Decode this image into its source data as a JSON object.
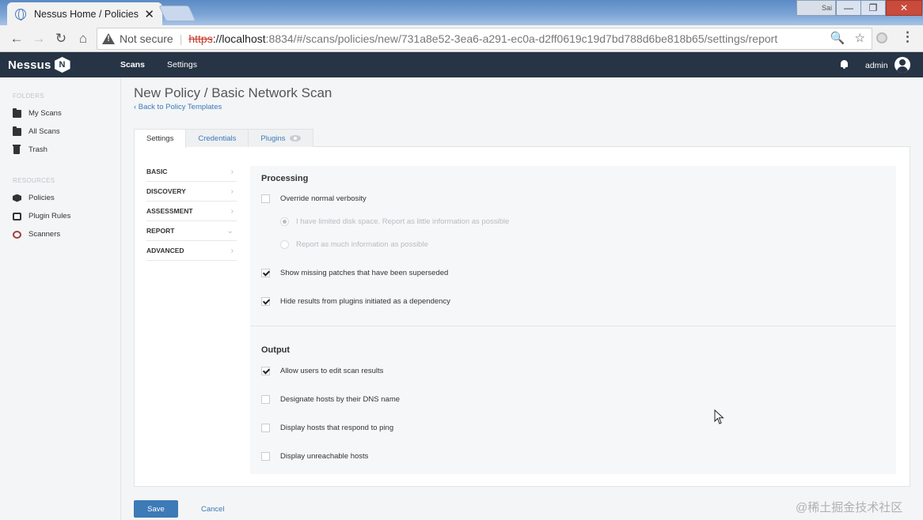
{
  "browser": {
    "tab_title": "Nessus Home / Policies /",
    "tab_close": "✕",
    "profile_label": "Sai",
    "minimize": "—",
    "restore": "❐",
    "close": "✕",
    "back": "←",
    "forward": "→",
    "reload": "↻",
    "home": "⌂",
    "security_label": "Not secure",
    "separator": "|",
    "url_scheme": "https",
    "url_host": "://localhost",
    "url_path": ":8834/#/scans/policies/new/731a8e52-3ea6-a291-ec0a-d2ff0619c19d7bd788d6be818b65/settings/report",
    "zoom_icon": "🔍",
    "bookmark_icon": "☆",
    "menu": "⋮"
  },
  "topnav": {
    "logo_text": "Nessus",
    "logo_badge": "N",
    "scans": "Scans",
    "settings": "Settings",
    "user": "admin"
  },
  "sidebar": {
    "folders_heading": "FOLDERS",
    "my_scans": "My Scans",
    "all_scans": "All Scans",
    "trash": "Trash",
    "resources_heading": "RESOURCES",
    "policies": "Policies",
    "plugin_rules": "Plugin Rules",
    "scanners": "Scanners"
  },
  "page": {
    "title": "New Policy / Basic Network Scan",
    "back_link": "‹ Back to Policy Templates"
  },
  "tabs": {
    "settings": "Settings",
    "credentials": "Credentials",
    "plugins": "Plugins"
  },
  "section_nav": [
    {
      "label": "BASIC",
      "chevron": "›"
    },
    {
      "label": "DISCOVERY",
      "chevron": "›"
    },
    {
      "label": "ASSESSMENT",
      "chevron": "›"
    },
    {
      "label": "REPORT",
      "chevron": "⌄"
    },
    {
      "label": "ADVANCED",
      "chevron": "›"
    }
  ],
  "processing": {
    "title": "Processing",
    "override_verbosity": {
      "label": "Override normal verbosity",
      "checked": false
    },
    "limited_disk": {
      "label": "I have limited disk space. Report as little information as possible",
      "selected": true
    },
    "much_info": {
      "label": "Report as much information as possible",
      "selected": false
    },
    "show_missing_patches": {
      "label": "Show missing patches that have been superseded",
      "checked": true
    },
    "hide_results": {
      "label": "Hide results from plugins initiated as a dependency",
      "checked": true
    }
  },
  "output": {
    "title": "Output",
    "allow_edit": {
      "label": "Allow users to edit scan results",
      "checked": true
    },
    "dns_name": {
      "label": "Designate hosts by their DNS name",
      "checked": false
    },
    "respond_ping": {
      "label": "Display hosts that respond to ping",
      "checked": false
    },
    "unreachable": {
      "label": "Display unreachable hosts",
      "checked": false
    }
  },
  "actions": {
    "save": "Save",
    "cancel": "Cancel"
  },
  "watermark": "@稀土掘金技术社区",
  "colors": {
    "nav_bg": "#263445",
    "accent": "#3c7ab8"
  }
}
